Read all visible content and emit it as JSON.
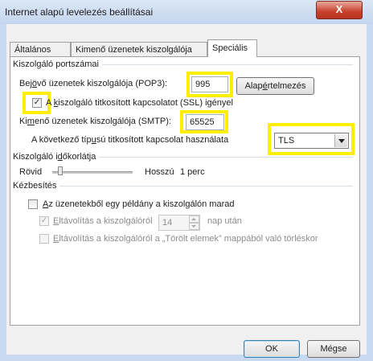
{
  "window": {
    "title": "Internet alapú levelezés beállításai",
    "close_glyph": "X"
  },
  "tabs": [
    {
      "label": "Általános"
    },
    {
      "label": "Kimenő üzenetek kiszolgálója"
    },
    {
      "label": "Speciális"
    }
  ],
  "server_ports": {
    "group_title": "Kiszolgáló portszámai",
    "incoming": {
      "label_pre": "Bej",
      "label_key": "ö",
      "label_post": "vő üzenetek kiszolgálója (POP3):",
      "value": "995"
    },
    "default_button": {
      "pre": "Alap",
      "key": "é",
      "post": "rtelmezés"
    },
    "ssl_checkbox": {
      "checked": true,
      "glyph": "✓",
      "label_pre": "A ",
      "label_key": "k",
      "label_post": "iszolgáló titkosított kapcsolatot (SSL) igényel"
    },
    "outgoing": {
      "label_pre": "Ki",
      "label_key": "m",
      "label_post": "enő üzenetek kiszolgálója (SMTP):",
      "value": "65525"
    },
    "encryption": {
      "label_pre": "A következő típ",
      "label_key": "u",
      "label_post": "sú titkosított kapcsolat használata",
      "selected": "TLS"
    }
  },
  "timeout": {
    "group_title_pre": "Kiszolgáló i",
    "group_title_key": "d",
    "group_title_post": "őkorlátja",
    "short_label": "Rövid",
    "long_label": "Hosszú",
    "value": "1 perc",
    "slider_level": 0.1
  },
  "delivery": {
    "group_title": "Kézbesítés",
    "leave_copy": {
      "checked": false,
      "label_key": "A",
      "label_post": "z üzenetekből egy példány a kiszolgálón marad"
    },
    "remove_after": {
      "checked": true,
      "glyph": "✓",
      "label_key": "E",
      "label_post": "ltávolítás a kiszolgálóról",
      "days": "14",
      "suffix": "nap után"
    },
    "remove_deleted": {
      "checked": false,
      "label_key": "E",
      "label_post": "ltávolítás a kiszolgálóról a „Törölt elemek” mappából való törléskor"
    }
  },
  "buttons": {
    "ok": "OK",
    "cancel": "Mégse"
  },
  "colors": {
    "highlight": "#ffee00",
    "close": "#c7412c"
  }
}
